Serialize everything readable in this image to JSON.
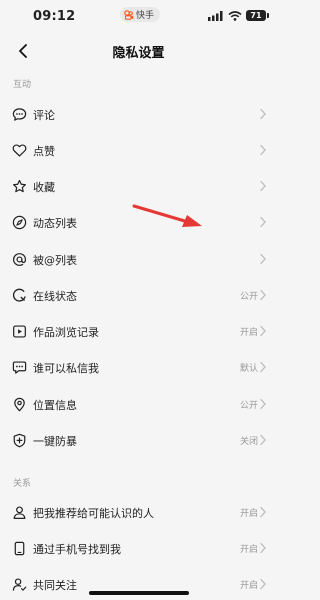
{
  "status_bar": {
    "time": "09:12",
    "app_badge": "快手",
    "battery": "71"
  },
  "nav": {
    "title": "隐私设置"
  },
  "sections": {
    "interaction": "互动",
    "relations": "关系"
  },
  "rows": [
    {
      "icon": "comment-icon",
      "label": "评论",
      "value": ""
    },
    {
      "icon": "heart-icon",
      "label": "点赞",
      "value": ""
    },
    {
      "icon": "star-icon",
      "label": "收藏",
      "value": ""
    },
    {
      "icon": "compass-icon",
      "label": "动态列表",
      "value": ""
    },
    {
      "icon": "at-icon",
      "label": "被@列表",
      "value": ""
    },
    {
      "icon": "online-status-icon",
      "label": "在线状态",
      "value": "公开"
    },
    {
      "icon": "browse-history-icon",
      "label": "作品浏览记录",
      "value": "开启"
    },
    {
      "icon": "message-icon",
      "label": "谁可以私信我",
      "value": "默认"
    },
    {
      "icon": "location-icon",
      "label": "位置信息",
      "value": "公开"
    },
    {
      "icon": "shield-plus-icon",
      "label": "一键防暴",
      "value": "关闭"
    },
    {
      "icon": "person-icon",
      "label": "把我推荐给可能认识的人",
      "value": "开启"
    },
    {
      "icon": "phone-icon",
      "label": "通过手机号找到我",
      "value": "开启"
    },
    {
      "icon": "mutual-follow-icon",
      "label": "共同关注",
      "value": "开启"
    }
  ]
}
